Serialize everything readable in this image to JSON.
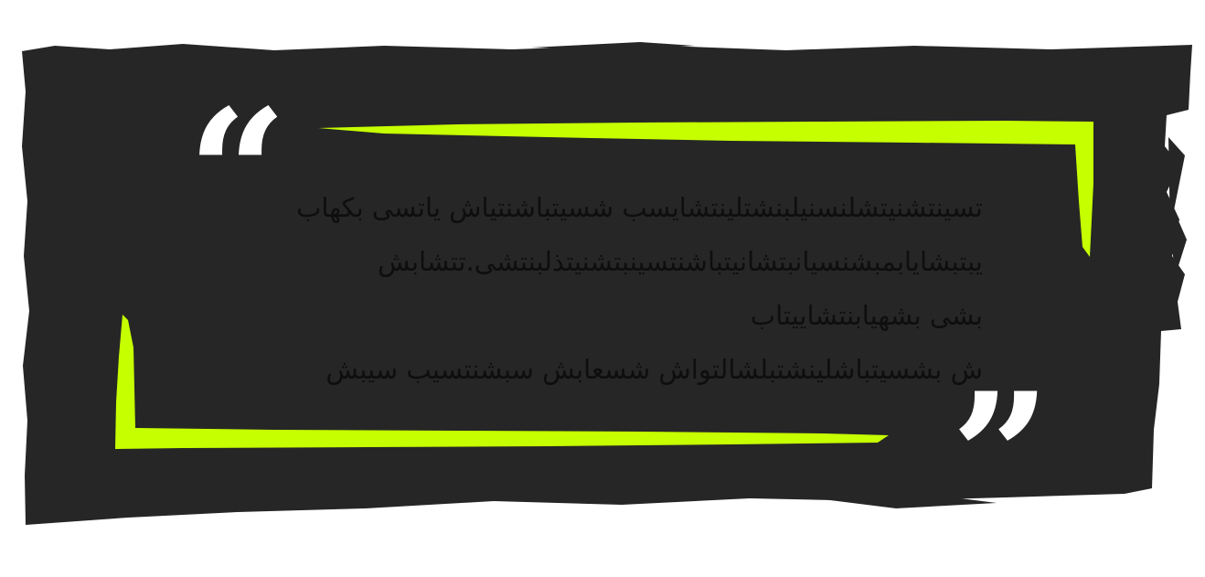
{
  "quote": {
    "lines": [
      "تسینتشنیتشلنسنیلبنشتلینتشایسب شسیتباشنتیاش یاتسی بکهاب",
      "یبتبشایابمبشنسیانبتشانیتباشنتسینبتشنیتذلبنتشی.تتشابش",
      "بشی بشهیابنتشاییتاب",
      "ش بشسیتباشلینشتبلشالتواش شسعابش سبشنتسیب سیبش"
    ],
    "open_mark": "“",
    "close_mark": "”"
  },
  "colors": {
    "background": "#ffffff",
    "panel": "#262626",
    "accent": "#c6ff00",
    "text": "#0e0e0e",
    "quote_mark": "#ffffff"
  }
}
